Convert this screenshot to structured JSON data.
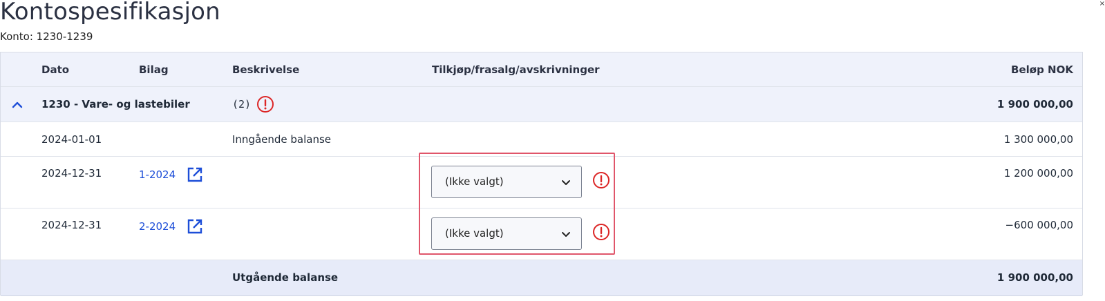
{
  "page": {
    "title": "Kontospesifikasjon",
    "subtitle": "Konto: 1230-1239"
  },
  "table": {
    "columns": {
      "dato": "Dato",
      "bilag": "Bilag",
      "beskrivelse": "Beskrivelse",
      "tilkjop": "Tilkjøp/frasalg/avskrivninger",
      "belop": "Beløp NOK"
    },
    "group": {
      "label": "1230 - Vare- og lastebiler",
      "count": "(2)",
      "amount": "1 900 000,00",
      "expanded": true
    },
    "rows": [
      {
        "date": "2024-01-01",
        "voucher": "",
        "description": "Inngående balanse",
        "select": "",
        "amount": "1 300 000,00"
      },
      {
        "date": "2024-12-31",
        "voucher": "1-2024",
        "description": "",
        "select": "(Ikke valgt)",
        "amount": "1 200 000,00"
      },
      {
        "date": "2024-12-31",
        "voucher": "2-2024",
        "description": "",
        "select": "(Ikke valgt)",
        "amount": "−600 000,00"
      }
    ],
    "footer": {
      "label": "Utgående balanse",
      "amount": "1 900 000,00"
    }
  },
  "colors": {
    "link": "#1d4ed8",
    "warning": "#dc2626",
    "highlight": "#e0556a",
    "header_bg": "#eff2fb",
    "footer_bg": "#e7ebf9"
  },
  "icons": {
    "expand": "chevron-up-icon",
    "external": "external-link-icon",
    "warning": "warning-circle-icon",
    "dropdown": "chevron-down-icon"
  }
}
